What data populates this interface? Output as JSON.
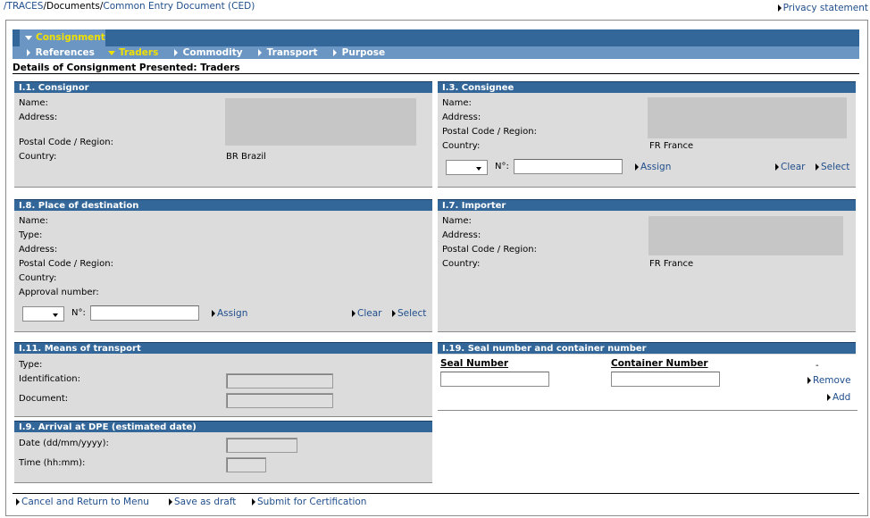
{
  "breadcrumb": {
    "traces": "/TRACES",
    "documents": "/Documents/",
    "ced": "Common Entry Document (CED)"
  },
  "privacy": "Privacy statement",
  "tabs": {
    "main": "Consignment",
    "sub": [
      {
        "label": "References"
      },
      {
        "label": "Traders"
      },
      {
        "label": "Commodity"
      },
      {
        "label": "Transport"
      },
      {
        "label": "Purpose"
      }
    ]
  },
  "section_title": "Details of Consignment Presented: Traders",
  "consignor": {
    "title": "I.1. Consignor",
    "name_label": "Name:",
    "address_label": "Address:",
    "postal_label": "Postal Code / Region:",
    "country_label": "Country:",
    "country_value": "BR Brazil"
  },
  "consignee": {
    "title": "I.3. Consignee",
    "name_label": "Name:",
    "address_label": "Address:",
    "postal_label": "Postal Code / Region:",
    "country_label": "Country:",
    "country_value": "FR France",
    "no_label": "N°:",
    "assign": "Assign",
    "clear": "Clear",
    "select": "Select"
  },
  "destination": {
    "title": "I.8. Place of destination",
    "name_label": "Name:",
    "type_label": "Type:",
    "address_label": "Address:",
    "postal_label": "Postal Code / Region:",
    "country_label": "Country:",
    "approval_label": "Approval number:",
    "no_label": "N°:",
    "assign": "Assign",
    "clear": "Clear",
    "select": "Select"
  },
  "importer": {
    "title": "I.7. Importer",
    "name_label": "Name:",
    "address_label": "Address:",
    "postal_label": "Postal Code / Region:",
    "country_label": "Country:",
    "country_value": "FR France"
  },
  "transport": {
    "title": "I.11. Means of transport",
    "type_label": "Type:",
    "identification_label": "Identification:",
    "document_label": "Document:"
  },
  "arrival": {
    "title": "I.9. Arrival at DPE (estimated date)",
    "date_label": "Date (dd/mm/yyyy):",
    "time_label": "Time (hh:mm):"
  },
  "seal": {
    "title": "I.19. Seal number and container number",
    "seal_header": "Seal Number",
    "container_header": "Container Number",
    "dash": "-",
    "remove": "Remove",
    "add": "Add"
  },
  "footer": {
    "cancel": "Cancel and Return to Menu",
    "save": "Save as draft",
    "submit": "Submit for Certification"
  }
}
